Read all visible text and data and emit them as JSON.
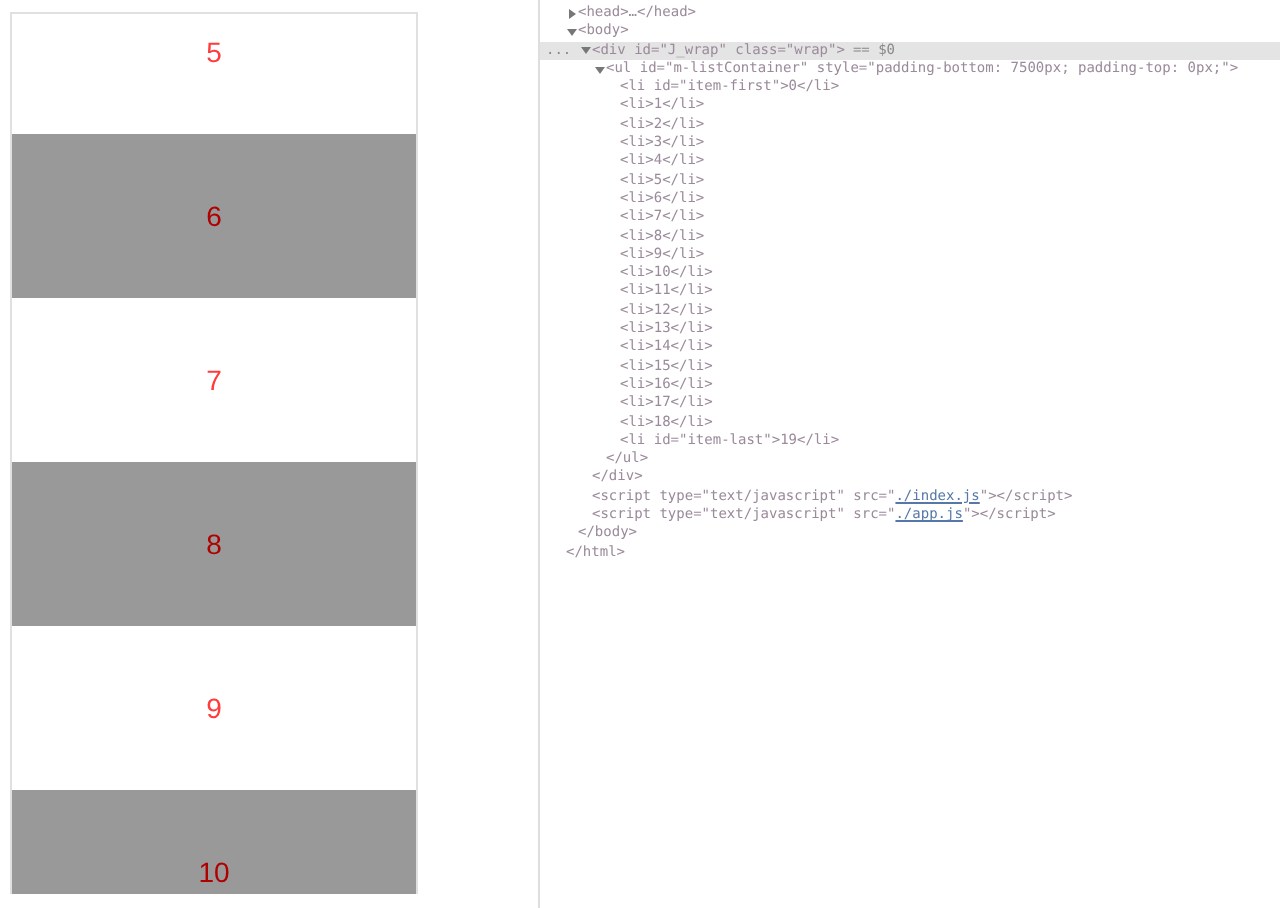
{
  "list_items": [
    {
      "label": "5",
      "shaded": false
    },
    {
      "label": "6",
      "shaded": true
    },
    {
      "label": "7",
      "shaded": false
    },
    {
      "label": "8",
      "shaded": true
    },
    {
      "label": "9",
      "shaded": false
    },
    {
      "label": "10",
      "shaded": true
    }
  ],
  "elements_tree": [
    {
      "text": "<head>…</head>",
      "expanded": false
    },
    {
      "text": "<body>",
      "expanded": true,
      "closing": "</body>",
      "children": [
        {
          "text": "<div id=\"J_wrap\" class=\"wrap\">",
          "gutter": "...",
          "suffix": "== $0",
          "selected": true,
          "expanded": true,
          "closing": "</div>",
          "children": [
            {
              "text": "<ul id=\"m-listContainer\" style=\"padding-bottom: 7500px; padding-top: 0px;\">",
              "expanded": true,
              "closing": "</ul>",
              "children": [
                {
                  "text": "<li id=\"item-first\">0</li>"
                },
                {
                  "text": "<li>1</li>"
                },
                {
                  "text": "<li>2</li>"
                },
                {
                  "text": "<li>3</li>"
                },
                {
                  "text": "<li>4</li>"
                },
                {
                  "text": "<li>5</li>"
                },
                {
                  "text": "<li>6</li>"
                },
                {
                  "text": "<li>7</li>"
                },
                {
                  "text": "<li>8</li>"
                },
                {
                  "text": "<li>9</li>"
                },
                {
                  "text": "<li>10</li>"
                },
                {
                  "text": "<li>11</li>"
                },
                {
                  "text": "<li>12</li>"
                },
                {
                  "text": "<li>13</li>"
                },
                {
                  "text": "<li>14</li>"
                },
                {
                  "text": "<li>15</li>"
                },
                {
                  "text": "<li>16</li>"
                },
                {
                  "text": "<li>17</li>"
                },
                {
                  "text": "<li>18</li>"
                },
                {
                  "text": "<li id=\"item-last\">19</li>"
                }
              ]
            }
          ]
        },
        {
          "text": "<script type=\"text/javascript\" src=\"",
          "link": "./index.js",
          "after": "\"></script>"
        },
        {
          "text": "<script type=\"text/javascript\" src=\"",
          "link": "./app.js",
          "after": "\"></script>"
        }
      ]
    }
  ],
  "closing_html": "</html>"
}
